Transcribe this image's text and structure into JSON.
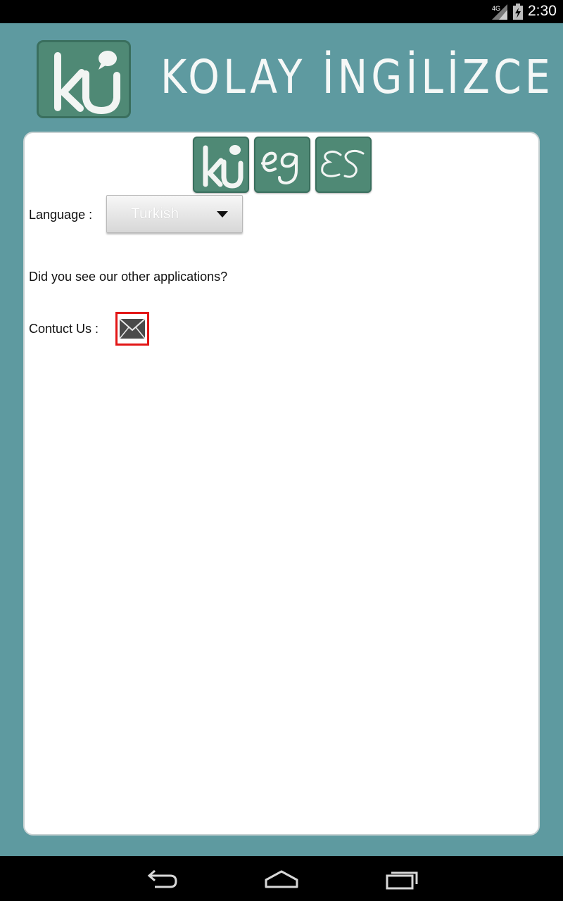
{
  "status_bar": {
    "network_type": "4G",
    "time": "2:30"
  },
  "header": {
    "title": "KOLAY İNGİLİZCE",
    "logo_icon": "ki-logo-icon"
  },
  "app_icons": [
    {
      "name": "ki-app-icon",
      "text": "ki"
    },
    {
      "name": "eg-app-icon",
      "text": "eg"
    },
    {
      "name": "es-app-icon",
      "text": "ES"
    }
  ],
  "settings": {
    "language_label": "Language :",
    "language_value": "Turkish",
    "other_apps_text": "Did you see our other applications?",
    "contact_label": "Contuct Us :",
    "contact_icon": "mail-icon"
  },
  "nav_bar": {
    "back_icon": "back-icon",
    "home_icon": "home-icon",
    "recents_icon": "recents-icon"
  },
  "colors": {
    "background": "#5e9aa0",
    "icon_green": "#4f8975",
    "contact_highlight": "#e21616"
  }
}
